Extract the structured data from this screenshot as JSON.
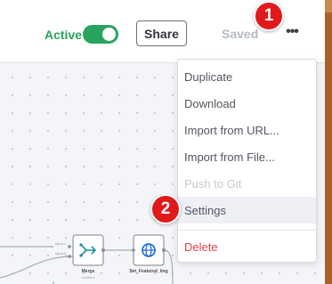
{
  "header": {
    "active_label": "Active",
    "active_toggle_on": true,
    "share_label": "Share",
    "status_label": "Saved",
    "more_icon": "more-horizontal-icon"
  },
  "annotations": {
    "badge_1": "1",
    "badge_2": "2"
  },
  "menu": {
    "items": [
      {
        "label": "Duplicate",
        "disabled": false
      },
      {
        "label": "Download",
        "disabled": false
      },
      {
        "label": "Import from URL...",
        "disabled": false
      },
      {
        "label": "Import from File...",
        "disabled": false
      },
      {
        "label": "Push to Git",
        "disabled": true
      },
      {
        "label": "Settings",
        "disabled": false,
        "highlighted": true
      },
      {
        "label": "Delete",
        "disabled": false,
        "danger": true
      }
    ]
  },
  "canvas": {
    "nodes": [
      {
        "name": "Merge",
        "subtitle": "combine",
        "icon": "merge-icon"
      },
      {
        "name": "Set_Featured_Img",
        "subtitle": "",
        "icon": "globe-icon"
      }
    ],
    "inputs": [
      "Input 1",
      "Input 2"
    ]
  },
  "colors": {
    "active_green": "#2aa35e",
    "badge_red": "#e01a1a",
    "delete_red": "#e0434c",
    "accent_blue": "#1565d8",
    "merge_teal": "#1b8fa3"
  }
}
